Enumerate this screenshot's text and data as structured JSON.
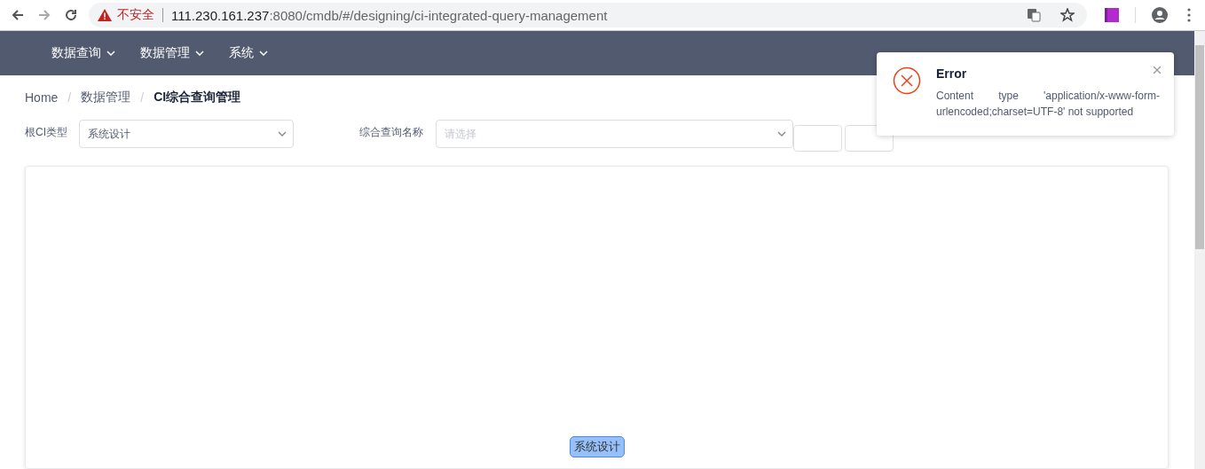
{
  "browser": {
    "security_label": "不安全",
    "url_host": "111.230.161.237",
    "url_rest": ":8080/cmdb/#/designing/ci-integrated-query-management"
  },
  "nav": {
    "menus": [
      {
        "label": "数据查询"
      },
      {
        "label": "数据管理"
      },
      {
        "label": "系统"
      }
    ]
  },
  "breadcrumb": [
    {
      "label": "Home",
      "current": false
    },
    {
      "separator_before": "/",
      "label": "数据管理",
      "current": false
    },
    {
      "separator_before": "/",
      "label": "CI综合查询管理",
      "current": true
    }
  ],
  "filters": {
    "root_ci_type": {
      "label": "根CI类型",
      "value": "系统设计"
    },
    "query_name": {
      "label": "综合查询名称",
      "placeholder": "请选择"
    }
  },
  "graph": {
    "nodes": [
      {
        "label": "系统设计"
      }
    ]
  },
  "notification": {
    "title": "Error",
    "message": "Content type 'application/x-www-form-urlencoded;charset=UTF-8' not supported"
  }
}
